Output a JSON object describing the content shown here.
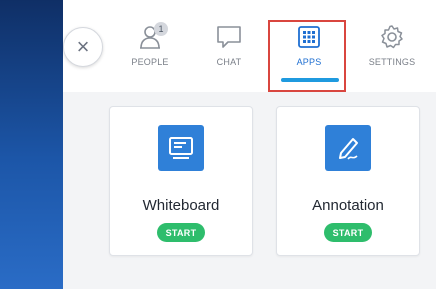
{
  "header": {
    "close_glyph": "×",
    "tabs": [
      {
        "label": "PEOPLE",
        "icon": "people-icon",
        "badge": "1"
      },
      {
        "label": "CHAT",
        "icon": "chat-icon"
      },
      {
        "label": "APPS",
        "icon": "apps-grid-icon",
        "active": true
      },
      {
        "label": "SETTINGS",
        "icon": "gear-icon"
      }
    ]
  },
  "apps": [
    {
      "name": "Whiteboard",
      "icon": "whiteboard-icon",
      "action": "START"
    },
    {
      "name": "Annotation",
      "icon": "annotation-pen-icon",
      "action": "START"
    }
  ],
  "colors": {
    "accent": "#1f6fd1",
    "start_green": "#2ebd6c",
    "highlight_red": "#d9463f",
    "tile_blue": "#2f80d8",
    "rail_blue": "#1c56a8"
  }
}
